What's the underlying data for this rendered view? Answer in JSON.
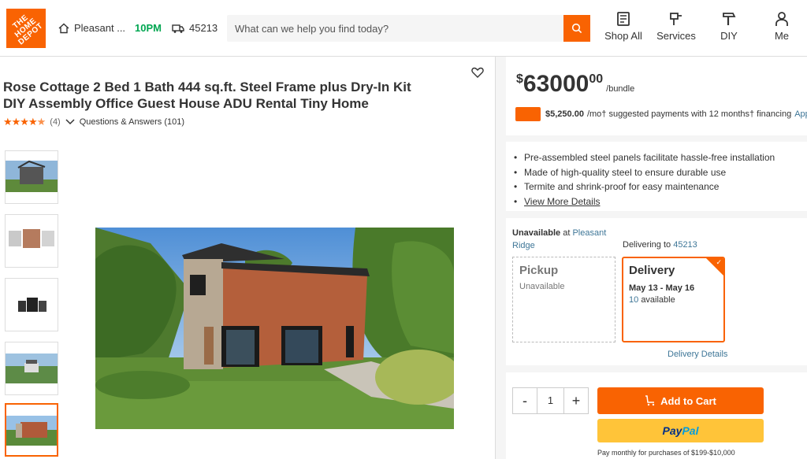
{
  "brand": {
    "logo_text": "THE HOME DEPOT",
    "accent": "#f96302"
  },
  "header": {
    "store_name": "Pleasant ...",
    "store_hours": "10PM",
    "zip": "45213",
    "search_placeholder": "What can we help you find today?",
    "nav": [
      {
        "label": "Shop All",
        "icon": "shop-all-icon"
      },
      {
        "label": "Services",
        "icon": "services-icon"
      },
      {
        "label": "DIY",
        "icon": "diy-hammer-icon"
      },
      {
        "label": "Me",
        "icon": "user-icon"
      }
    ]
  },
  "product": {
    "title_line1": "Rose Cottage 2 Bed 1 Bath 444 sq.ft. Steel Frame plus Dry-In Kit",
    "title_line2": "DIY Assembly Office Guest House ADU Rental Tiny Home",
    "rating_stars": 4.5,
    "review_count": "(4)",
    "qa": "Questions & Answers (101)"
  },
  "pricing": {
    "dollar_sign": "$",
    "price": "63000",
    "cents": "00",
    "unit": "/bundle",
    "financing_amount": "$5,250.00",
    "financing_text": "/mo† suggested payments with 12 months† financing",
    "financing_link": "Apply"
  },
  "highlights": [
    "Pre-assembled steel panels facilitate hassle-free installation",
    "Made of high-quality steel to ensure durable use",
    "Termite and shrink-proof for easy maintenance"
  ],
  "highlights_link": "View More Details",
  "fulfillment": {
    "unavailable_label": "Unavailable",
    "at_text": "at",
    "store_line1": "Pleasant",
    "store_line2": "Ridge",
    "delivering_to": "Delivering to",
    "zip": "45213",
    "pickup_title": "Pickup",
    "pickup_status": "Unavailable",
    "delivery_title": "Delivery",
    "delivery_dates": "May 13 - May 16",
    "delivery_qty": "10",
    "delivery_avail": "available",
    "details_link": "Delivery Details"
  },
  "purchase": {
    "minus": "-",
    "quantity": "1",
    "plus": "+",
    "add_to_cart": "Add to Cart",
    "paypal_1": "Pay",
    "paypal_2": "Pal",
    "pay_note": "Pay monthly for purchases of $199-$10,000"
  }
}
